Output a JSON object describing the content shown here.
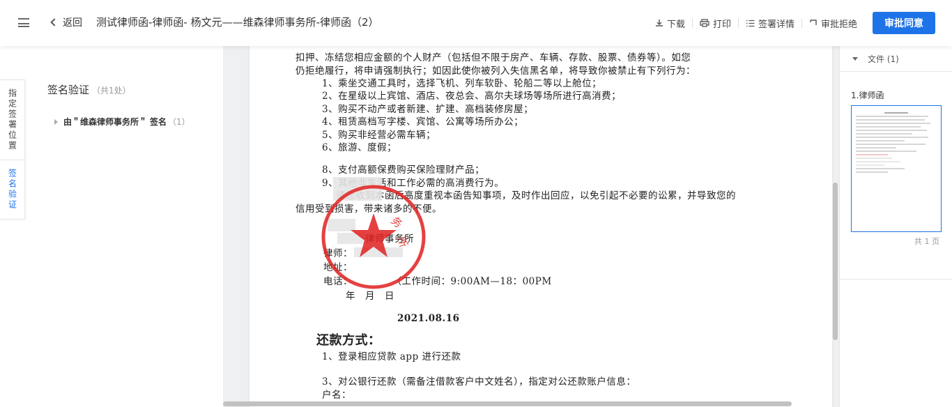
{
  "header": {
    "back_label": "返回",
    "title": "测试律师函-律师函- 杨文元——维森律师事务所-律师函（2）",
    "actions": {
      "download": "下载",
      "print": "打印",
      "sign_details": "签署详情",
      "reject": "审批拒绝",
      "approve": "审批同意"
    }
  },
  "left_panel": {
    "vtabs": [
      "指定签署位置",
      "签名验证"
    ],
    "section_title": "签名验证",
    "section_count": "（共1处）",
    "signature_item": {
      "prefix": "由＂维森律师事务所＂",
      "label": "签名",
      "count": "（1）"
    }
  },
  "document": {
    "lines": [
      "扣押、冻结您相应金额的个人财产（包括但不限于房产、车辆、存款、股票、债券等）。如您",
      "仍拒绝履行，将申请强制执行；如因此使你被列入失信黑名单，将导致你被禁止有下列行为：",
      "1、乘坐交通工具时，选择飞机、列车软卧、轮船二等以上舱位；",
      "2、在星级以上宾馆、酒店、夜总会、高尔夫球场等场所进行高消费；",
      "3、购买不动产或者新建、扩建、高档装修房屋；",
      "4、租赁高档写字楼、宾馆、公寓等场所办公；",
      "5、购买非经营必需车辆；",
      "6、旅游、度假；",
      "8、支付高额保费购买保险理财产品；",
      "9、其他非生活和工作必需的高消费行为。",
      "请您收到本函后高度重视本函告知事项，及时作出回应，以免引起不必要的讼累，并导致您的",
      "信用受到损害，带来诸多的不便。",
      "律师事务所",
      "律师：",
      "地址：",
      "电话：　　　　　（工作时间：9:00AM—18：00PM",
      "年　月　日",
      "2021.08.16",
      "还款方式：",
      "1、登录相应贷款 app 进行还款",
      "3、对公银行还款（需备注借款客户中文姓名），指定对公还款账户信息：",
      "户名："
    ]
  },
  "right_panel": {
    "files_header": "文件 (1)",
    "file_name": "1.律师函",
    "page_count": "共 1 页"
  },
  "colors": {
    "accent": "#1e73e8",
    "stamp_red": "#e02020"
  }
}
